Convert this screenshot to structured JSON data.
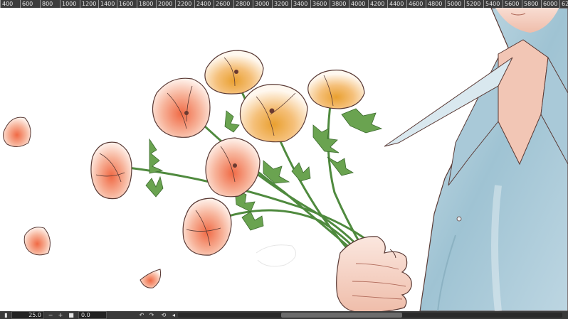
{
  "ruler": {
    "ticks": [
      "400",
      "600",
      "800",
      "1000",
      "1200",
      "1400",
      "1600",
      "1800",
      "2000",
      "2200",
      "2400",
      "2600",
      "2800",
      "3000",
      "3200",
      "3400",
      "3600",
      "3800",
      "4000",
      "4200",
      "4400",
      "4600",
      "4800",
      "5000",
      "5200",
      "5400",
      "5600",
      "5800",
      "6000",
      "62"
    ]
  },
  "status": {
    "zoom_value": "25.0",
    "zoom_out_glyph": "−",
    "zoom_in_glyph": "+",
    "rotation_value": "0.0",
    "rotate_left_glyph": "↶",
    "rotate_right_glyph": "↷",
    "reset_glyph": "⟲",
    "prev_glyph": "◂"
  },
  "canvas": {
    "petal_color": "#ee8a6a",
    "stem_color": "#5e9a4a",
    "shirt_color": "#b9d3e0",
    "skin_color": "#f3d1c4",
    "line_color": "#5a3a35"
  }
}
